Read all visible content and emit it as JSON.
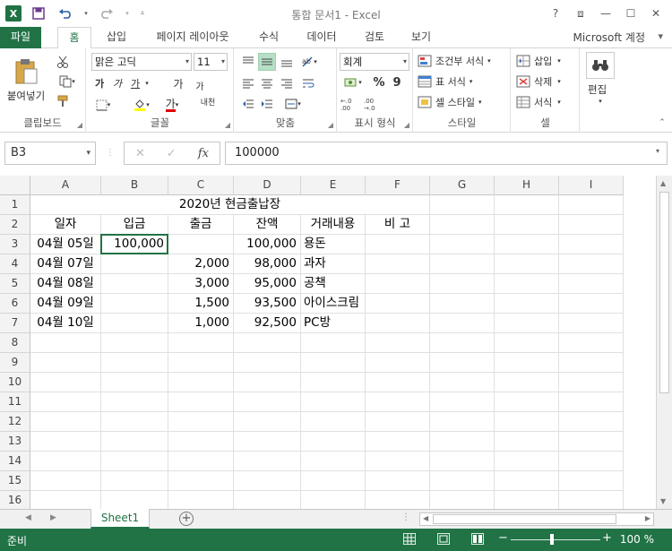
{
  "window": {
    "title": "통합 문서1 - Excel",
    "help": "?",
    "ribbon_display": "⧈",
    "minimize": "—",
    "restore": "☐",
    "close": "✕"
  },
  "quick_access": {
    "logo": "X",
    "save_icon": "save-icon",
    "undo_icon": "undo-icon",
    "redo_icon": "redo-icon"
  },
  "tabs": [
    "파일",
    "홈",
    "삽입",
    "페이지 레이아웃",
    "수식",
    "데이터",
    "검토",
    "보기"
  ],
  "account": "Microsoft 계정",
  "ribbon": {
    "clipboard": {
      "label": "클립보드",
      "paste": "붙여넣기"
    },
    "font": {
      "label": "글꼴",
      "font_name": "맑은 고딕",
      "font_size": "11",
      "bold": "가",
      "italic": "가",
      "underline": "가",
      "grow": "가",
      "shrink": "가",
      "phonetic": "내천"
    },
    "alignment": {
      "label": "맞춤"
    },
    "number": {
      "label": "표시 형식",
      "format": "회계",
      "percent": "%",
      "comma": "9"
    },
    "styles": {
      "label": "스타일",
      "conditional": "조건부 서식",
      "table": "표 서식",
      "cell": "셀 스타일"
    },
    "cells": {
      "label": "셀",
      "insert": "삽입",
      "delete": "삭제",
      "format": "서식"
    },
    "editing": {
      "label": "편집"
    }
  },
  "formula_bar": {
    "name_box": "B3",
    "cancel": "✕",
    "enter": "✓",
    "fx": "fx",
    "value": "100000"
  },
  "columns": [
    "A",
    "B",
    "C",
    "D",
    "E",
    "F",
    "G",
    "H",
    "I"
  ],
  "rows": [
    "1",
    "2",
    "3",
    "4",
    "5",
    "6",
    "7",
    "8",
    "9",
    "10",
    "11",
    "12",
    "13",
    "14",
    "15",
    "16"
  ],
  "sheet": {
    "title": "2020년 현금출납장",
    "headers": [
      "일자",
      "입금",
      "출금",
      "잔액",
      "거래내용",
      "비  고"
    ],
    "data": [
      [
        "04월 05일",
        "100,000",
        "",
        "100,000",
        "용돈",
        ""
      ],
      [
        "04월 07일",
        "",
        "2,000",
        "98,000",
        "과자",
        ""
      ],
      [
        "04월 08일",
        "",
        "3,000",
        "95,000",
        "공책",
        ""
      ],
      [
        "04월 09일",
        "",
        "1,500",
        "93,500",
        "아이스크림",
        ""
      ],
      [
        "04월 10일",
        "",
        "1,000",
        "92,500",
        "PC방",
        ""
      ]
    ]
  },
  "sheet_tabs": [
    "Sheet1"
  ],
  "status": {
    "mode": "준비",
    "zoom": "100 %"
  }
}
